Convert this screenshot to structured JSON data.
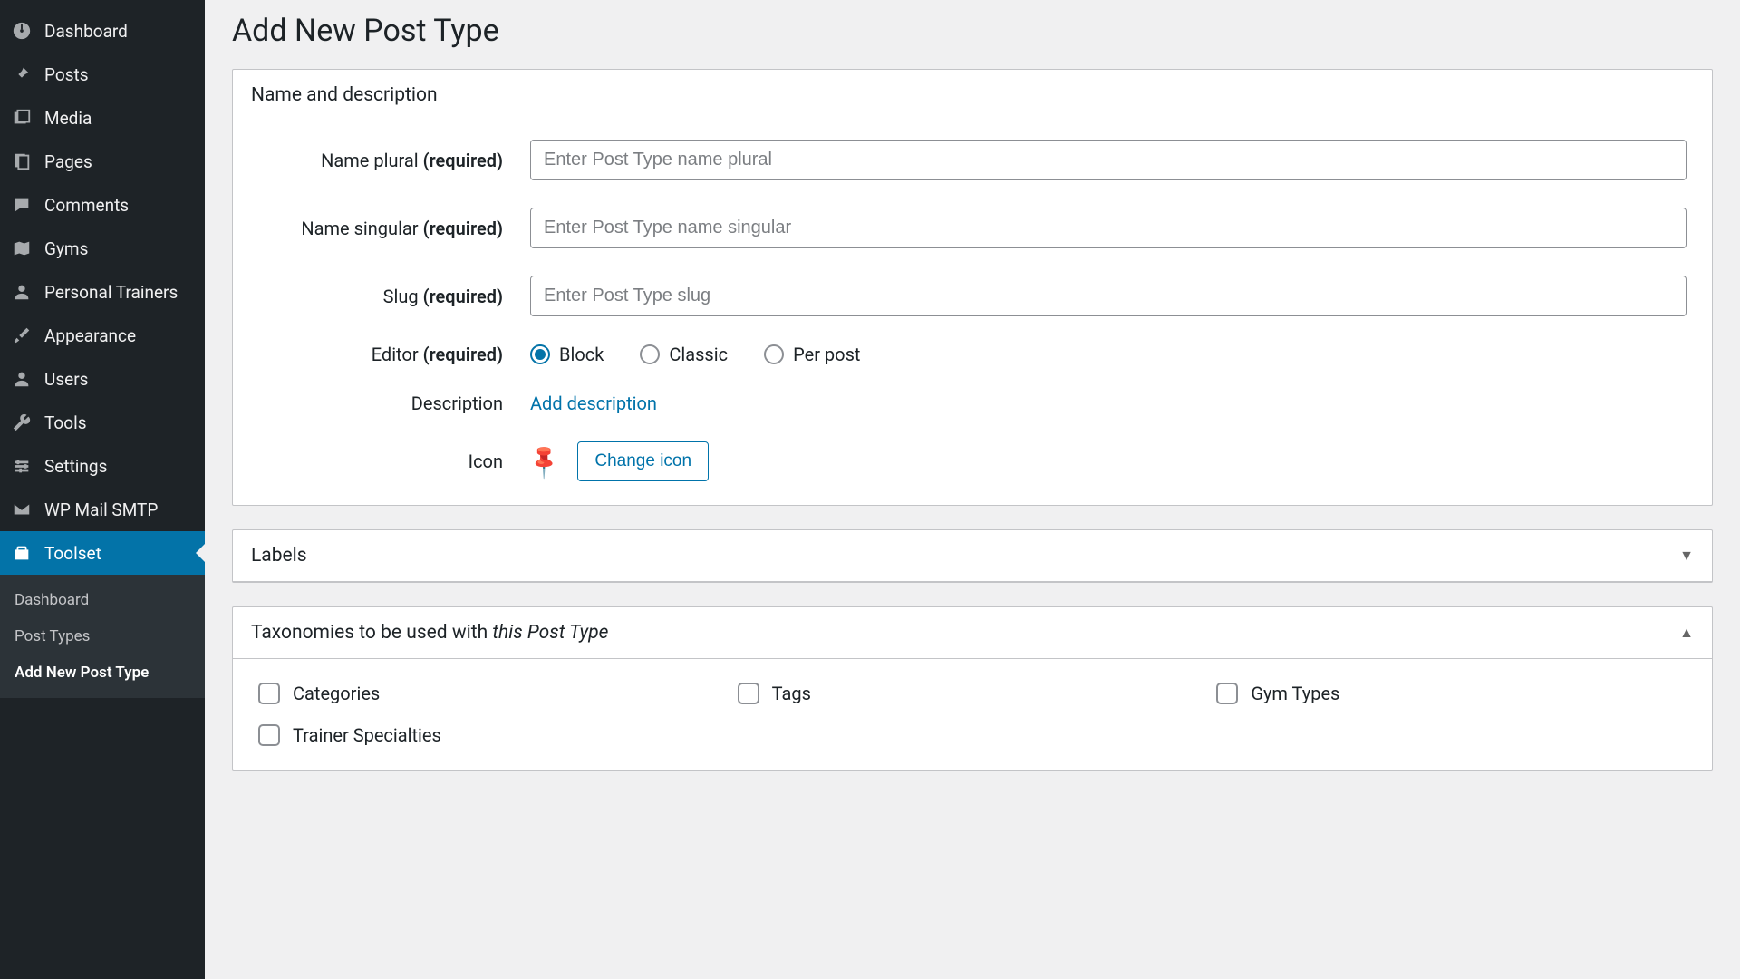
{
  "page": {
    "title": "Add New Post Type"
  },
  "sidebar": {
    "items": [
      {
        "label": "Dashboard",
        "icon": "dashboard"
      },
      {
        "label": "Posts",
        "icon": "pin"
      },
      {
        "label": "Media",
        "icon": "media"
      },
      {
        "label": "Pages",
        "icon": "page"
      },
      {
        "label": "Comments",
        "icon": "comment"
      },
      {
        "label": "Gyms",
        "icon": "map"
      },
      {
        "label": "Personal Trainers",
        "icon": "user"
      },
      {
        "label": "Appearance",
        "icon": "brush"
      },
      {
        "label": "Users",
        "icon": "user"
      },
      {
        "label": "Tools",
        "icon": "tools"
      },
      {
        "label": "Settings",
        "icon": "settings"
      },
      {
        "label": "WP Mail SMTP",
        "icon": "mail"
      },
      {
        "label": "Toolset",
        "icon": "toolset",
        "active": true
      }
    ],
    "sub": [
      {
        "label": "Dashboard"
      },
      {
        "label": "Post Types"
      },
      {
        "label": "Add New Post Type",
        "current": true
      }
    ]
  },
  "panels": {
    "nameDesc": {
      "title": "Name and description",
      "namePlural": {
        "label": "Name plural",
        "req": "(required)",
        "placeholder": "Enter Post Type name plural"
      },
      "nameSingular": {
        "label": "Name singular",
        "req": "(required)",
        "placeholder": "Enter Post Type name singular"
      },
      "slug": {
        "label": "Slug",
        "req": "(required)",
        "placeholder": "Enter Post Type slug"
      },
      "editor": {
        "label": "Editor",
        "req": "(required)",
        "options": [
          {
            "label": "Block",
            "checked": true
          },
          {
            "label": "Classic",
            "checked": false
          },
          {
            "label": "Per post",
            "checked": false
          }
        ]
      },
      "description": {
        "label": "Description",
        "action": "Add description"
      },
      "icon": {
        "label": "Icon",
        "button": "Change icon"
      }
    },
    "labels": {
      "title": "Labels"
    },
    "taxonomies": {
      "title_prefix": "Taxonomies to be used with ",
      "title_italic": "this Post Type",
      "options": [
        {
          "label": "Categories"
        },
        {
          "label": "Tags"
        },
        {
          "label": "Gym Types"
        },
        {
          "label": "Trainer Specialties"
        }
      ]
    }
  }
}
